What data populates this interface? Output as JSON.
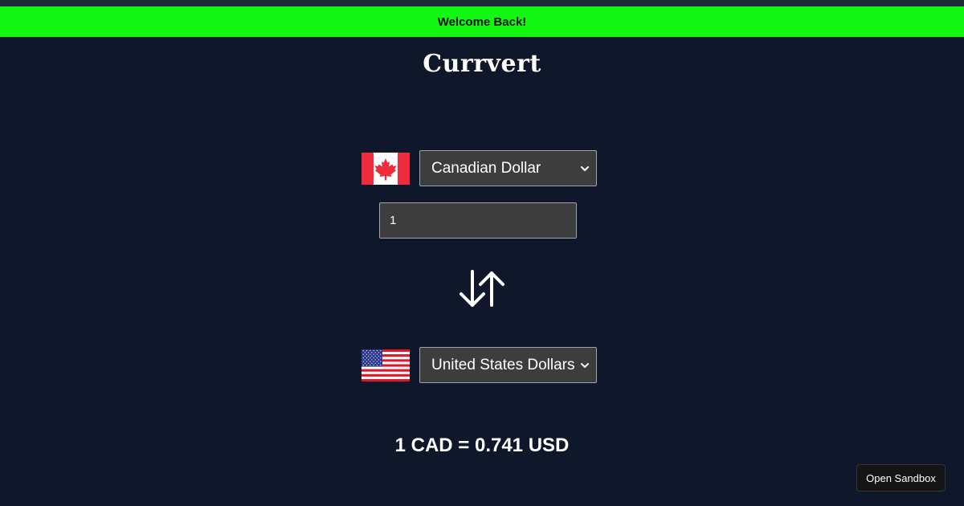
{
  "banner": {
    "text": "Welcome Back!",
    "color": "#12f812"
  },
  "app": {
    "title": "Currvert",
    "background": "#0f172a"
  },
  "from": {
    "flag_icon": "canada-flag-icon",
    "currency": "Canadian Dollar",
    "amount": "1"
  },
  "swap": {
    "icon": "swap-arrows-icon"
  },
  "to": {
    "flag_icon": "usa-flag-icon",
    "currency": "United States Dollars"
  },
  "result": {
    "text": "1 CAD = 0.741 USD"
  },
  "sandbox": {
    "label": "Open Sandbox"
  }
}
